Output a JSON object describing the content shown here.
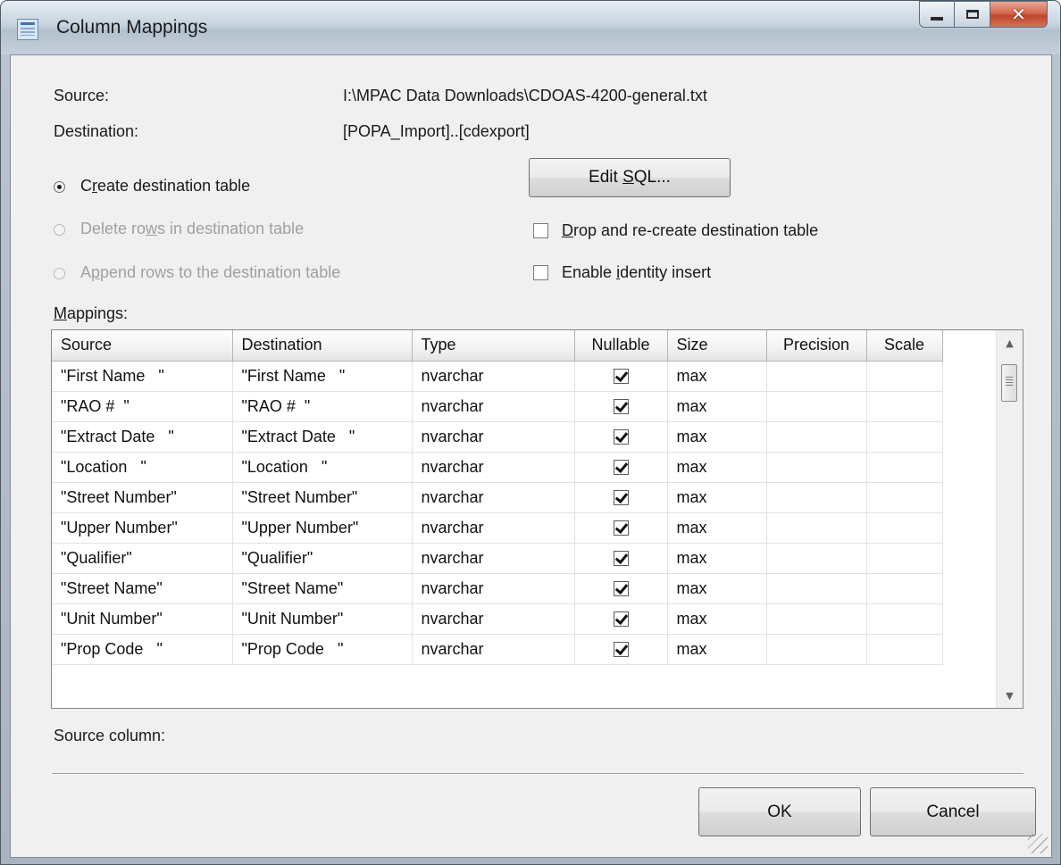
{
  "window": {
    "title": "Column Mappings"
  },
  "info": {
    "source_label": "Source:",
    "source_value": "I:\\MPAC Data Downloads\\CDOAS-4200-general.txt",
    "destination_label": "Destination:",
    "destination_value": "[POPA_Import]..[cdexport]"
  },
  "options": {
    "create_table": {
      "pre": "C",
      "accel": "r",
      "post": "eate destination table",
      "selected": true,
      "enabled": true
    },
    "delete_rows": {
      "pre": "Delete ro",
      "accel": "w",
      "post": "s in destination table",
      "selected": false,
      "enabled": false
    },
    "append_rows": {
      "pre": "A",
      "accel": "p",
      "post": "pend rows to the destination table",
      "selected": false,
      "enabled": false
    },
    "edit_sql": {
      "pre": "Edit ",
      "accel": "S",
      "post": "QL..."
    },
    "drop_recreate": {
      "pre": "",
      "accel": "D",
      "post": "rop and re-create destination table",
      "checked": false
    },
    "identity_insert": {
      "pre": "Enable ",
      "accel": "i",
      "post": "dentity insert",
      "checked": false
    }
  },
  "mappings": {
    "label_accel": "M",
    "label_rest": "appings:",
    "columns": [
      "Source",
      "Destination",
      "Type",
      "Nullable",
      "Size",
      "Precision",
      "Scale"
    ],
    "rows": [
      {
        "source": "\"First Name   \"",
        "destination": "\"First Name   \"",
        "type": "nvarchar",
        "nullable": true,
        "size": "max",
        "precision": "",
        "scale": ""
      },
      {
        "source": "\"RAO #  \"",
        "destination": "\"RAO #  \"",
        "type": "nvarchar",
        "nullable": true,
        "size": "max",
        "precision": "",
        "scale": ""
      },
      {
        "source": "\"Extract Date   \"",
        "destination": "\"Extract Date   \"",
        "type": "nvarchar",
        "nullable": true,
        "size": "max",
        "precision": "",
        "scale": ""
      },
      {
        "source": "\"Location   \"",
        "destination": "\"Location   \"",
        "type": "nvarchar",
        "nullable": true,
        "size": "max",
        "precision": "",
        "scale": ""
      },
      {
        "source": "\"Street Number\"",
        "destination": "\"Street Number\"",
        "type": "nvarchar",
        "nullable": true,
        "size": "max",
        "precision": "",
        "scale": ""
      },
      {
        "source": "\"Upper Number\"",
        "destination": "\"Upper Number\"",
        "type": "nvarchar",
        "nullable": true,
        "size": "max",
        "precision": "",
        "scale": ""
      },
      {
        "source": "\"Qualifier\"",
        "destination": "\"Qualifier\"",
        "type": "nvarchar",
        "nullable": true,
        "size": "max",
        "precision": "",
        "scale": ""
      },
      {
        "source": "\"Street Name\"",
        "destination": "\"Street Name\"",
        "type": "nvarchar",
        "nullable": true,
        "size": "max",
        "precision": "",
        "scale": ""
      },
      {
        "source": "\"Unit Number\"",
        "destination": "\"Unit Number\"",
        "type": "nvarchar",
        "nullable": true,
        "size": "max",
        "precision": "",
        "scale": ""
      },
      {
        "source": "\"Prop Code   \"",
        "destination": "\"Prop Code   \"",
        "type": "nvarchar",
        "nullable": true,
        "size": "max",
        "precision": "",
        "scale": ""
      }
    ]
  },
  "footer": {
    "source_column_label": "Source column:",
    "ok_label": "OK",
    "cancel_label": "Cancel"
  }
}
